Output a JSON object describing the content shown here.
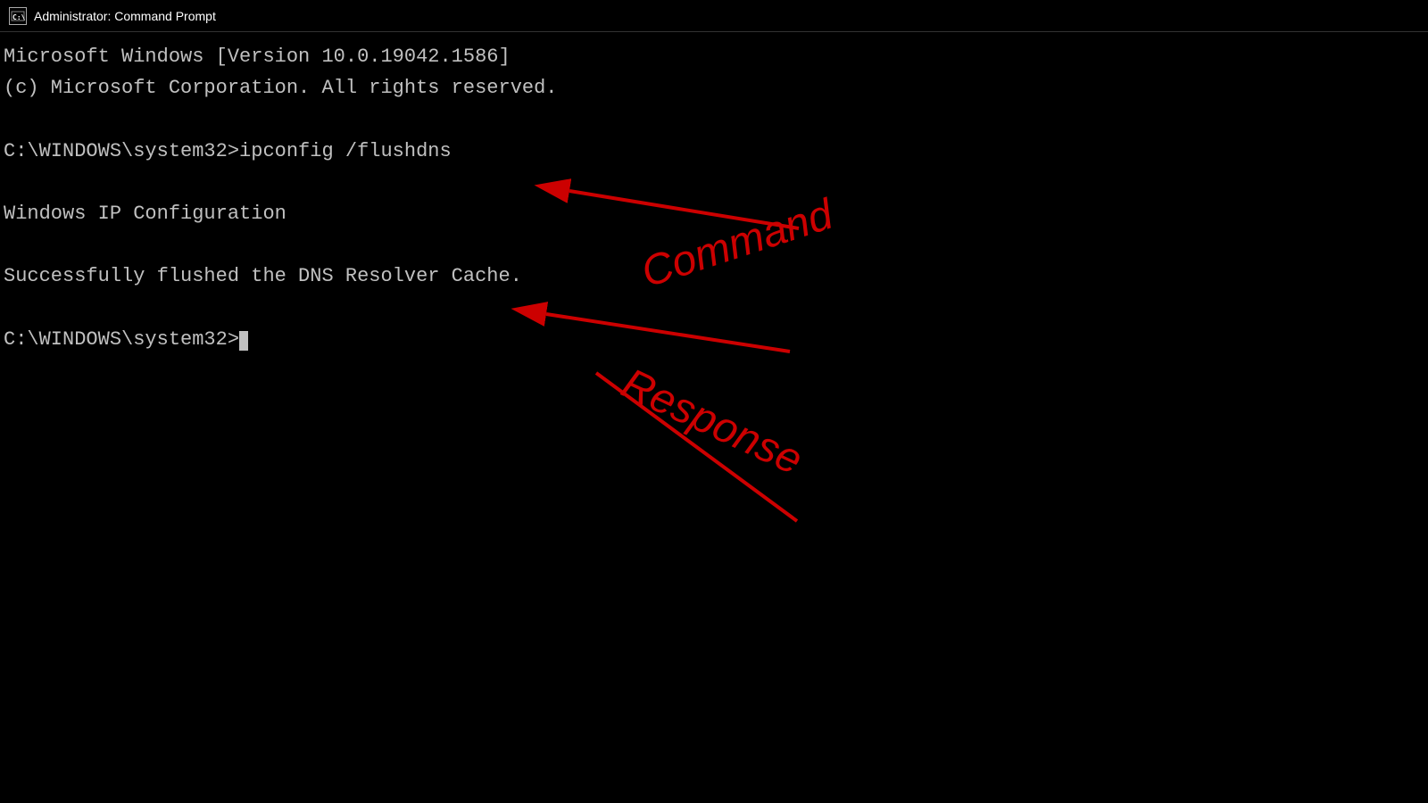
{
  "titlebar": {
    "icon_label": "C:\\",
    "title": "Administrator: Command Prompt"
  },
  "terminal": {
    "line1": "Microsoft Windows [Version 10.0.19042.1586]",
    "line2": "(c) Microsoft Corporation. All rights reserved.",
    "line3": "",
    "line4": "C:\\WINDOWS\\system32>ipconfig /flushdns",
    "line5": "",
    "line6": "Windows IP Configuration",
    "line7": "",
    "line8": "Successfully flushed the DNS Resolver Cache.",
    "line9": "",
    "line10": "C:\\WINDOWS\\system32>",
    "prompt_suffix": "_"
  },
  "annotations": {
    "command_label": "Command",
    "response_label": "Response"
  },
  "colors": {
    "terminal_text": "#c0c0c0",
    "background": "#000000",
    "annotation": "#cc0000",
    "titlebar_bg": "#000000",
    "titlebar_text": "#ffffff"
  }
}
